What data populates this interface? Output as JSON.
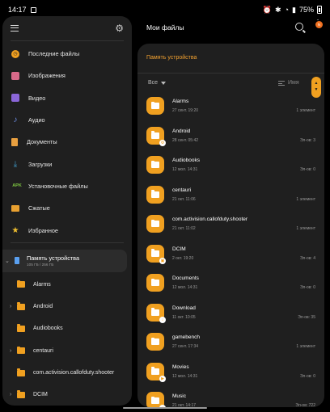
{
  "status": {
    "time": "14:17",
    "battery": "75%"
  },
  "left": {
    "nav": [
      {
        "label": "Последние файлы",
        "icon": "clock-icon",
        "name": "nav-recent",
        "cls": "ico-recent",
        "glyph": "◷"
      },
      {
        "label": "Изображения",
        "icon": "image-icon",
        "name": "nav-images",
        "cls": "ico-img",
        "glyph": ""
      },
      {
        "label": "Видео",
        "icon": "video-icon",
        "name": "nav-video",
        "cls": "ico-video",
        "glyph": ""
      },
      {
        "label": "Аудио",
        "icon": "music-note-icon",
        "name": "nav-audio",
        "cls": "ico-audio",
        "glyph": "♪"
      },
      {
        "label": "Документы",
        "icon": "document-icon",
        "name": "nav-documents",
        "cls": "ico-doc",
        "glyph": ""
      },
      {
        "label": "Загрузки",
        "icon": "download-icon",
        "name": "nav-downloads",
        "cls": "ico-dl",
        "glyph": "⤓"
      },
      {
        "label": "Установочные файлы",
        "icon": "apk-icon",
        "name": "nav-apk",
        "cls": "ico-apk",
        "glyph": "APK"
      },
      {
        "label": "Сжатые",
        "icon": "archive-icon",
        "name": "nav-compressed",
        "cls": "ico-zip",
        "glyph": ""
      },
      {
        "label": "Избранное",
        "icon": "star-icon",
        "name": "nav-favorites",
        "cls": "ico-fav",
        "glyph": "★"
      }
    ],
    "storage": {
      "title": "Память устройства",
      "subtitle": "105 ГБ / 256 ГБ"
    },
    "tree": [
      {
        "label": "Alarms",
        "expandable": false
      },
      {
        "label": "Android",
        "expandable": true
      },
      {
        "label": "Audiobooks",
        "expandable": false
      },
      {
        "label": "centauri",
        "expandable": true
      },
      {
        "label": "com.activision.callofduty.shooter",
        "expandable": false
      },
      {
        "label": "DCIM",
        "expandable": true
      }
    ]
  },
  "right": {
    "title": "Мои файлы",
    "badge": "N",
    "location": "Память устройства",
    "filter": "Все",
    "sort": "Имя",
    "files": [
      {
        "name": "Alarms",
        "date": "27 сент. 19:20",
        "count": "1 элемент",
        "sub": ""
      },
      {
        "name": "Android",
        "date": "28 сент. 05:42",
        "count": "Эл-ов: 3",
        "sub": "⚙"
      },
      {
        "name": "Audiobooks",
        "date": "12 мол. 14:31",
        "count": "Эл-ов: 0",
        "sub": ""
      },
      {
        "name": "centauri",
        "date": "21 окт. 11:06",
        "count": "1 элемент",
        "sub": ""
      },
      {
        "name": "com.activision.callofduty.shooter",
        "date": "21 окт. 11:02",
        "count": "1 элемент",
        "sub": ""
      },
      {
        "name": "DCIM",
        "date": "2 окт. 19:20",
        "count": "Эл-ов: 4",
        "sub": "▣"
      },
      {
        "name": "Documents",
        "date": "12 мол. 14:31",
        "count": "Эл-ов: 0",
        "sub": ""
      },
      {
        "name": "Download",
        "date": "11 окт. 10:05",
        "count": "Эл-ов: 35",
        "sub": "↓"
      },
      {
        "name": "gamebench",
        "date": "27 сент. 17:34",
        "count": "1 элемент",
        "sub": ""
      },
      {
        "name": "Movies",
        "date": "12 мол. 14:31",
        "count": "Эл-ов: 0",
        "sub": "▶"
      },
      {
        "name": "Music",
        "date": "21 окт. 14:17",
        "count": "Эл-ов: 722",
        "sub": "♪"
      }
    ]
  }
}
